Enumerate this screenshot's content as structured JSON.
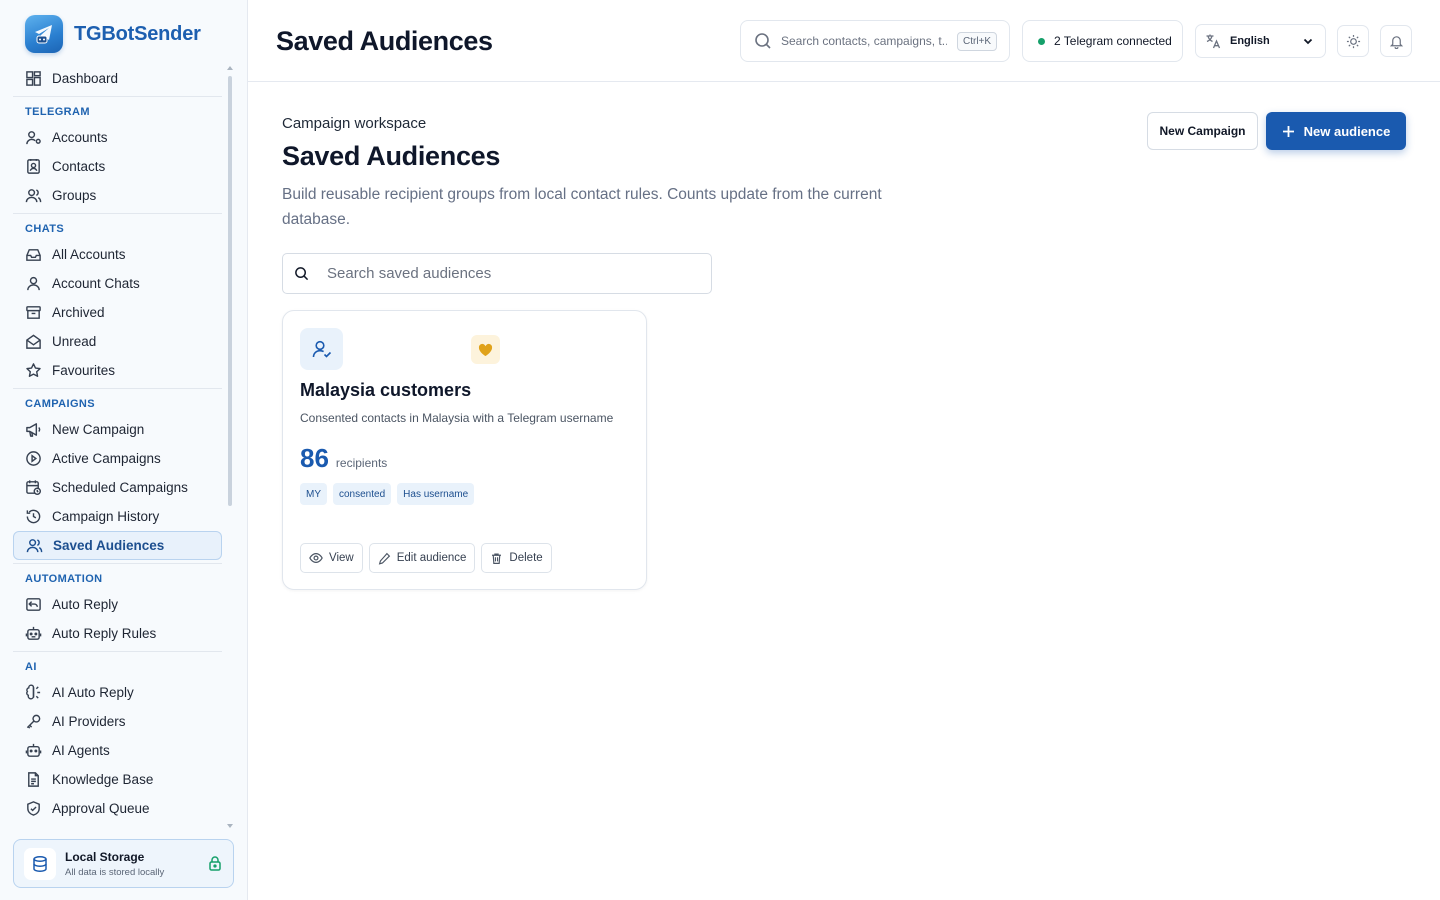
{
  "app": {
    "name": "TGBotSender"
  },
  "sidebar": {
    "dashboard": "Dashboard",
    "sections": {
      "telegram": "TELEGRAM",
      "chats": "CHATS",
      "campaigns": "CAMPAIGNS",
      "automation": "AUTOMATION",
      "ai": "AI"
    },
    "telegram": [
      "Accounts",
      "Contacts",
      "Groups"
    ],
    "chats": [
      "All Accounts",
      "Account Chats",
      "Archived",
      "Unread",
      "Favourites"
    ],
    "campaigns": [
      "New Campaign",
      "Active Campaigns",
      "Scheduled Campaigns",
      "Campaign History",
      "Saved Audiences"
    ],
    "automation": [
      "Auto Reply",
      "Auto Reply Rules"
    ],
    "ai": [
      "AI Auto Reply",
      "AI Providers",
      "AI Agents",
      "Knowledge Base",
      "Approval Queue"
    ],
    "active_item": "Saved Audiences",
    "storage": {
      "title": "Local Storage",
      "subtitle": "All data is stored locally"
    }
  },
  "header": {
    "title": "Saved Audiences",
    "search_placeholder": "Search contacts, campaigns, t...",
    "shortcut": "Ctrl+K",
    "telegram_status": "2 Telegram connected",
    "language": "English"
  },
  "main": {
    "eyebrow": "Campaign workspace",
    "title": "Saved Audiences",
    "description": "Build reusable recipient groups from local contact rules. Counts update from the current database.",
    "new_campaign_label": "New Campaign",
    "new_audience_label": "New audience",
    "search_placeholder": "Search saved audiences",
    "audiences": [
      {
        "name": "Malaysia customers",
        "description": "Consented contacts in Malaysia with a Telegram username",
        "count": "86",
        "count_label": "recipients",
        "tags": [
          "MY",
          "consented",
          "Has username"
        ],
        "actions": {
          "view": "View",
          "edit": "Edit audience",
          "delete": "Delete"
        }
      }
    ]
  },
  "colors": {
    "accent": "#1a5aaf",
    "brand_text": "#1d5fb0",
    "section_label": "#1f63b0",
    "status_online": "#15a06a",
    "favourite": "#e0a21a"
  }
}
